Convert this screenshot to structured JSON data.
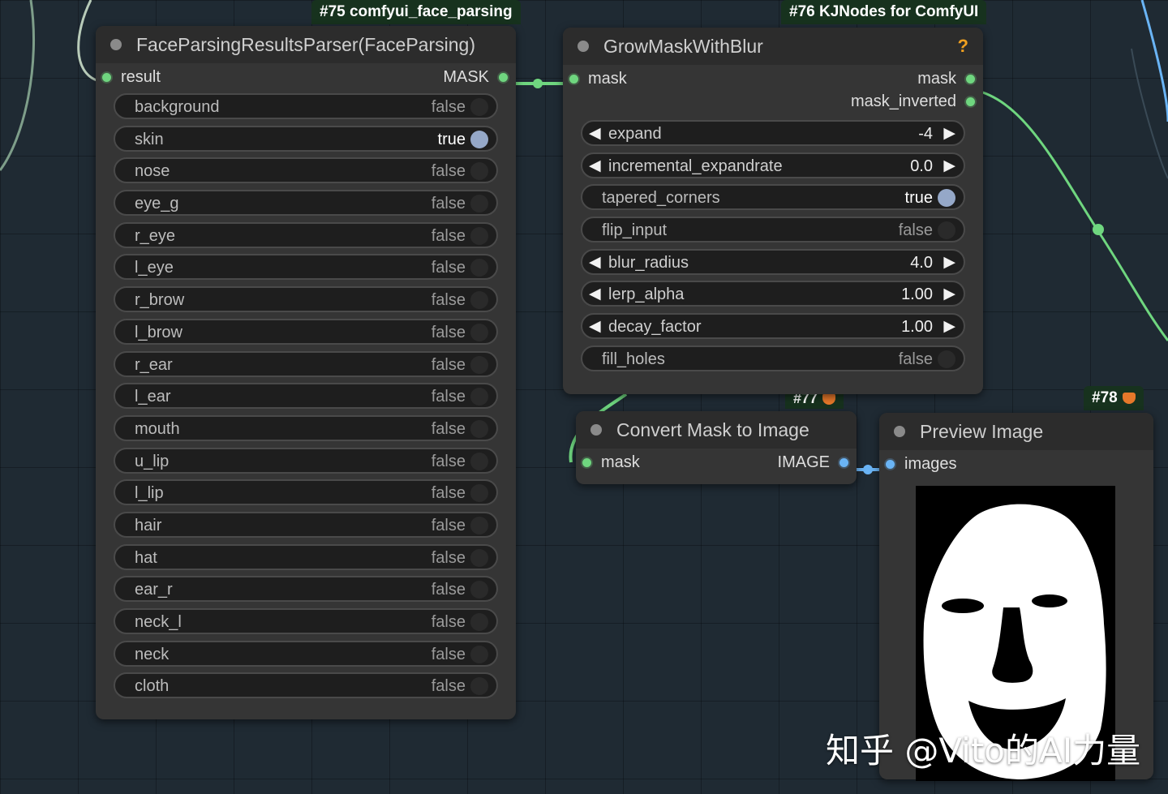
{
  "groups": {
    "g75": "#75 comfyui_face_parsing",
    "g76": "#76 KJNodes for ComfyUI",
    "g77": "#77",
    "g78": "#78"
  },
  "face_parser": {
    "title": "FaceParsingResultsParser(FaceParsing)",
    "input": "result",
    "output": "MASK",
    "widgets": [
      {
        "label": "background",
        "value": "false"
      },
      {
        "label": "skin",
        "value": "true"
      },
      {
        "label": "nose",
        "value": "false"
      },
      {
        "label": "eye_g",
        "value": "false"
      },
      {
        "label": "r_eye",
        "value": "false"
      },
      {
        "label": "l_eye",
        "value": "false"
      },
      {
        "label": "r_brow",
        "value": "false"
      },
      {
        "label": "l_brow",
        "value": "false"
      },
      {
        "label": "r_ear",
        "value": "false"
      },
      {
        "label": "l_ear",
        "value": "false"
      },
      {
        "label": "mouth",
        "value": "false"
      },
      {
        "label": "u_lip",
        "value": "false"
      },
      {
        "label": "l_lip",
        "value": "false"
      },
      {
        "label": "hair",
        "value": "false"
      },
      {
        "label": "hat",
        "value": "false"
      },
      {
        "label": "ear_r",
        "value": "false"
      },
      {
        "label": "neck_l",
        "value": "false"
      },
      {
        "label": "neck",
        "value": "false"
      },
      {
        "label": "cloth",
        "value": "false"
      }
    ]
  },
  "grow_mask": {
    "title": "GrowMaskWithBlur",
    "help": "?",
    "input": "mask",
    "outputs": [
      "mask",
      "mask_inverted"
    ],
    "widgets": [
      {
        "label": "expand",
        "value": "-4",
        "kind": "number"
      },
      {
        "label": "incremental_expandrate",
        "value": "0.0",
        "kind": "number"
      },
      {
        "label": "tapered_corners",
        "value": "true",
        "kind": "toggle"
      },
      {
        "label": "flip_input",
        "value": "false",
        "kind": "toggle"
      },
      {
        "label": "blur_radius",
        "value": "4.0",
        "kind": "number"
      },
      {
        "label": "lerp_alpha",
        "value": "1.00",
        "kind": "number"
      },
      {
        "label": "decay_factor",
        "value": "1.00",
        "kind": "number"
      },
      {
        "label": "fill_holes",
        "value": "false",
        "kind": "toggle"
      }
    ],
    "arrow_left": "◀",
    "arrow_right": "▶"
  },
  "convert_mask": {
    "title": "Convert Mask to Image",
    "input": "mask",
    "output": "IMAGE"
  },
  "preview": {
    "title": "Preview Image",
    "input": "images"
  },
  "watermark": "知乎 @Vito的AI力量",
  "colors": {
    "mask_wire": "#6fd67f",
    "image_wire": "#6ab4f5",
    "canvas": "#1f2a33",
    "node_body": "#353535",
    "group_tag": "#17321e"
  }
}
